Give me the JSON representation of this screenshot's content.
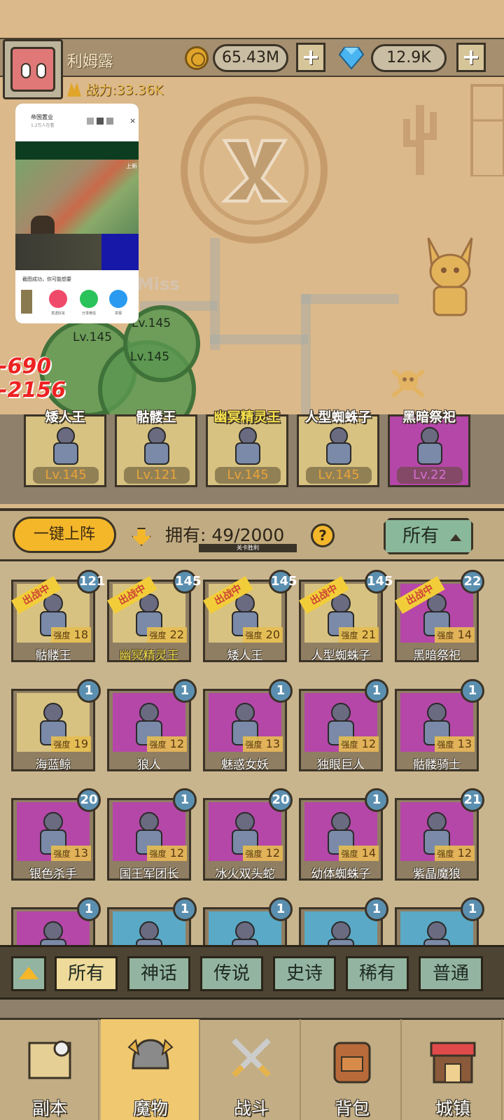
{
  "player": {
    "name": "利姆露",
    "power": "战力:33.36K"
  },
  "currency": {
    "gold": "65.43M",
    "gems": "12.9K",
    "plus": "+"
  },
  "map": {
    "miss": "Miss",
    "damage_1": "-690",
    "damage_2": "-2156",
    "unit_lv_1": "Lv.145",
    "unit_lv_2": "Lv.145",
    "unit_lv_3": "Lv.145"
  },
  "video_popup": {
    "title": "帝国置业",
    "subtitle": "1.2万人在看",
    "tag": "上新",
    "message": "截图成功，你可能想要",
    "actions": [
      "发送好友",
      "分享微信",
      "举报"
    ]
  },
  "team": [
    {
      "name": "矮人王",
      "lv": "Lv.145",
      "color": "gold",
      "highlight": false
    },
    {
      "name": "骷髅王",
      "lv": "Lv.121",
      "color": "gold",
      "highlight": false
    },
    {
      "name": "幽冥精灵王",
      "lv": "Lv.145",
      "color": "gold",
      "highlight": true
    },
    {
      "name": "人型蜘蛛子",
      "lv": "Lv.145",
      "color": "gold",
      "highlight": false
    },
    {
      "name": "黑暗祭祀",
      "lv": "Lv.22",
      "color": "purple",
      "highlight": false
    }
  ],
  "controls": {
    "deploy_all": "一键上阵",
    "own_label": "拥有:",
    "own_count": "49/2000",
    "own_sub": "关卡胜利",
    "help": "?",
    "filter_all": "所有"
  },
  "monsters": [
    {
      "name": "骷髅王",
      "lv": "121",
      "strength": "18",
      "deployed": true,
      "color": "gold",
      "highlight": false
    },
    {
      "name": "幽冥精灵王",
      "lv": "145",
      "strength": "22",
      "deployed": true,
      "color": "gold",
      "highlight": true
    },
    {
      "name": "矮人王",
      "lv": "145",
      "strength": "20",
      "deployed": true,
      "color": "gold",
      "highlight": false
    },
    {
      "name": "人型蜘蛛子",
      "lv": "145",
      "strength": "21",
      "deployed": true,
      "color": "gold",
      "highlight": false
    },
    {
      "name": "黑暗祭祀",
      "lv": "22",
      "strength": "14",
      "deployed": true,
      "color": "purple",
      "highlight": false
    },
    {
      "name": "海蓝鲸",
      "lv": "1",
      "strength": "19",
      "deployed": false,
      "color": "gold",
      "highlight": false
    },
    {
      "name": "狼人",
      "lv": "1",
      "strength": "12",
      "deployed": false,
      "color": "purple",
      "highlight": false
    },
    {
      "name": "魅惑女妖",
      "lv": "1",
      "strength": "13",
      "deployed": false,
      "color": "purple",
      "highlight": false
    },
    {
      "name": "独眼巨人",
      "lv": "1",
      "strength": "12",
      "deployed": false,
      "color": "purple",
      "highlight": false
    },
    {
      "name": "骷髅骑士",
      "lv": "1",
      "strength": "13",
      "deployed": false,
      "color": "purple",
      "highlight": false
    },
    {
      "name": "银色杀手",
      "lv": "20",
      "strength": "13",
      "deployed": false,
      "color": "purple",
      "highlight": false
    },
    {
      "name": "国王军团长",
      "lv": "1",
      "strength": "12",
      "deployed": false,
      "color": "purple",
      "highlight": false
    },
    {
      "name": "冰火双头蛇",
      "lv": "20",
      "strength": "12",
      "deployed": false,
      "color": "purple",
      "highlight": false
    },
    {
      "name": "幼体蜘蛛子",
      "lv": "1",
      "strength": "14",
      "deployed": false,
      "color": "purple",
      "highlight": false
    },
    {
      "name": "紫晶魔狼",
      "lv": "21",
      "strength": "12",
      "deployed": false,
      "color": "purple",
      "highlight": false
    },
    {
      "name": "",
      "lv": "1",
      "strength": "",
      "deployed": false,
      "color": "purple",
      "highlight": false
    },
    {
      "name": "",
      "lv": "1",
      "strength": "",
      "deployed": false,
      "color": "blue",
      "highlight": false
    },
    {
      "name": "",
      "lv": "1",
      "strength": "",
      "deployed": false,
      "color": "blue",
      "highlight": false
    },
    {
      "name": "",
      "lv": "1",
      "strength": "",
      "deployed": false,
      "color": "blue",
      "highlight": false
    },
    {
      "name": "",
      "lv": "1",
      "strength": "",
      "deployed": false,
      "color": "blue",
      "highlight": false
    }
  ],
  "labels": {
    "deployed_badge": "出战中",
    "strength": "强度"
  },
  "rarity_filters": [
    "所有",
    "神话",
    "传说",
    "史诗",
    "稀有",
    "普通"
  ],
  "active_filter": "所有",
  "nav": [
    {
      "label": "副本",
      "icon": "map-scroll-icon"
    },
    {
      "label": "魔物",
      "icon": "helmet-icon"
    },
    {
      "label": "战斗",
      "icon": "crossed-swords-icon"
    },
    {
      "label": "背包",
      "icon": "backpack-icon"
    },
    {
      "label": "城镇",
      "icon": "shop-icon"
    }
  ],
  "active_nav": "魔物",
  "colors": {
    "gold_card": "#d7c281",
    "purple_card": "#b547a8",
    "blue_card": "#5aa9c6",
    "accent": "#f4b72a",
    "lv_badge": "#5b8fb0"
  }
}
